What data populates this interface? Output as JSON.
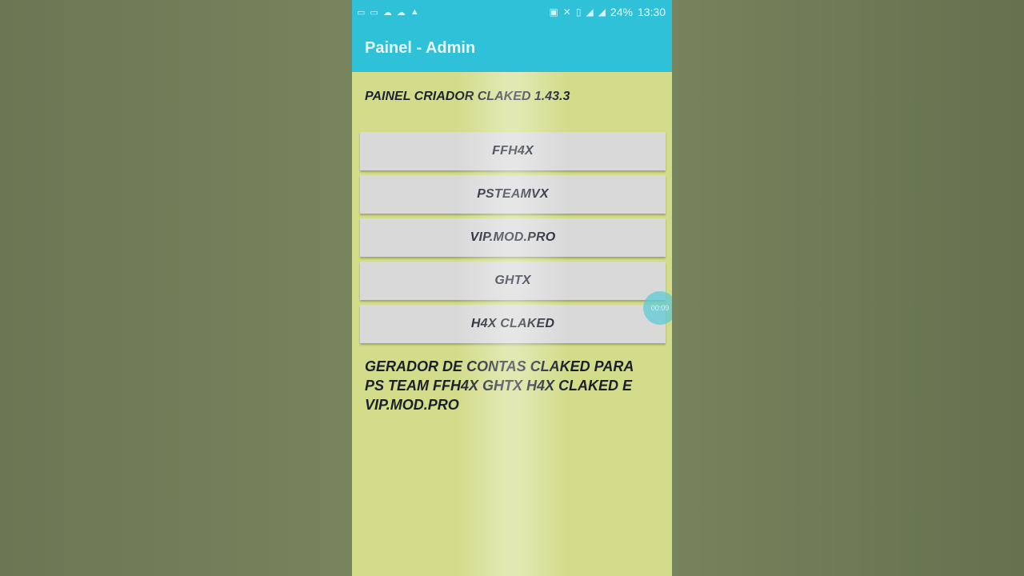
{
  "statusbar": {
    "left_icons": [
      "video-icon",
      "video-icon",
      "cloud-icon",
      "cloud-icon",
      "warning-icon"
    ],
    "battery": "24%",
    "time": "13:30"
  },
  "appbar": {
    "title": "Painel - Admin"
  },
  "content": {
    "header": "PAINEL CRIADOR CLAKED 1.43.3",
    "buttons": [
      {
        "label": "FFH4X"
      },
      {
        "label": "PSTEAMVX"
      },
      {
        "label": "VIP.MOD.PRO"
      },
      {
        "label": "GHTX"
      },
      {
        "label": "H4X CLAKED"
      }
    ],
    "footer": "GERADOR DE CONTAS CLAKED PARA PS TEAM FFH4X GHTX H4X CLAKED E VIP.MOD.PRO"
  },
  "bubble": {
    "label": "00:09"
  },
  "colors": {
    "appbar": "#2ec1d8",
    "background": "#d2dc8a",
    "button": "#d9d9d9"
  }
}
